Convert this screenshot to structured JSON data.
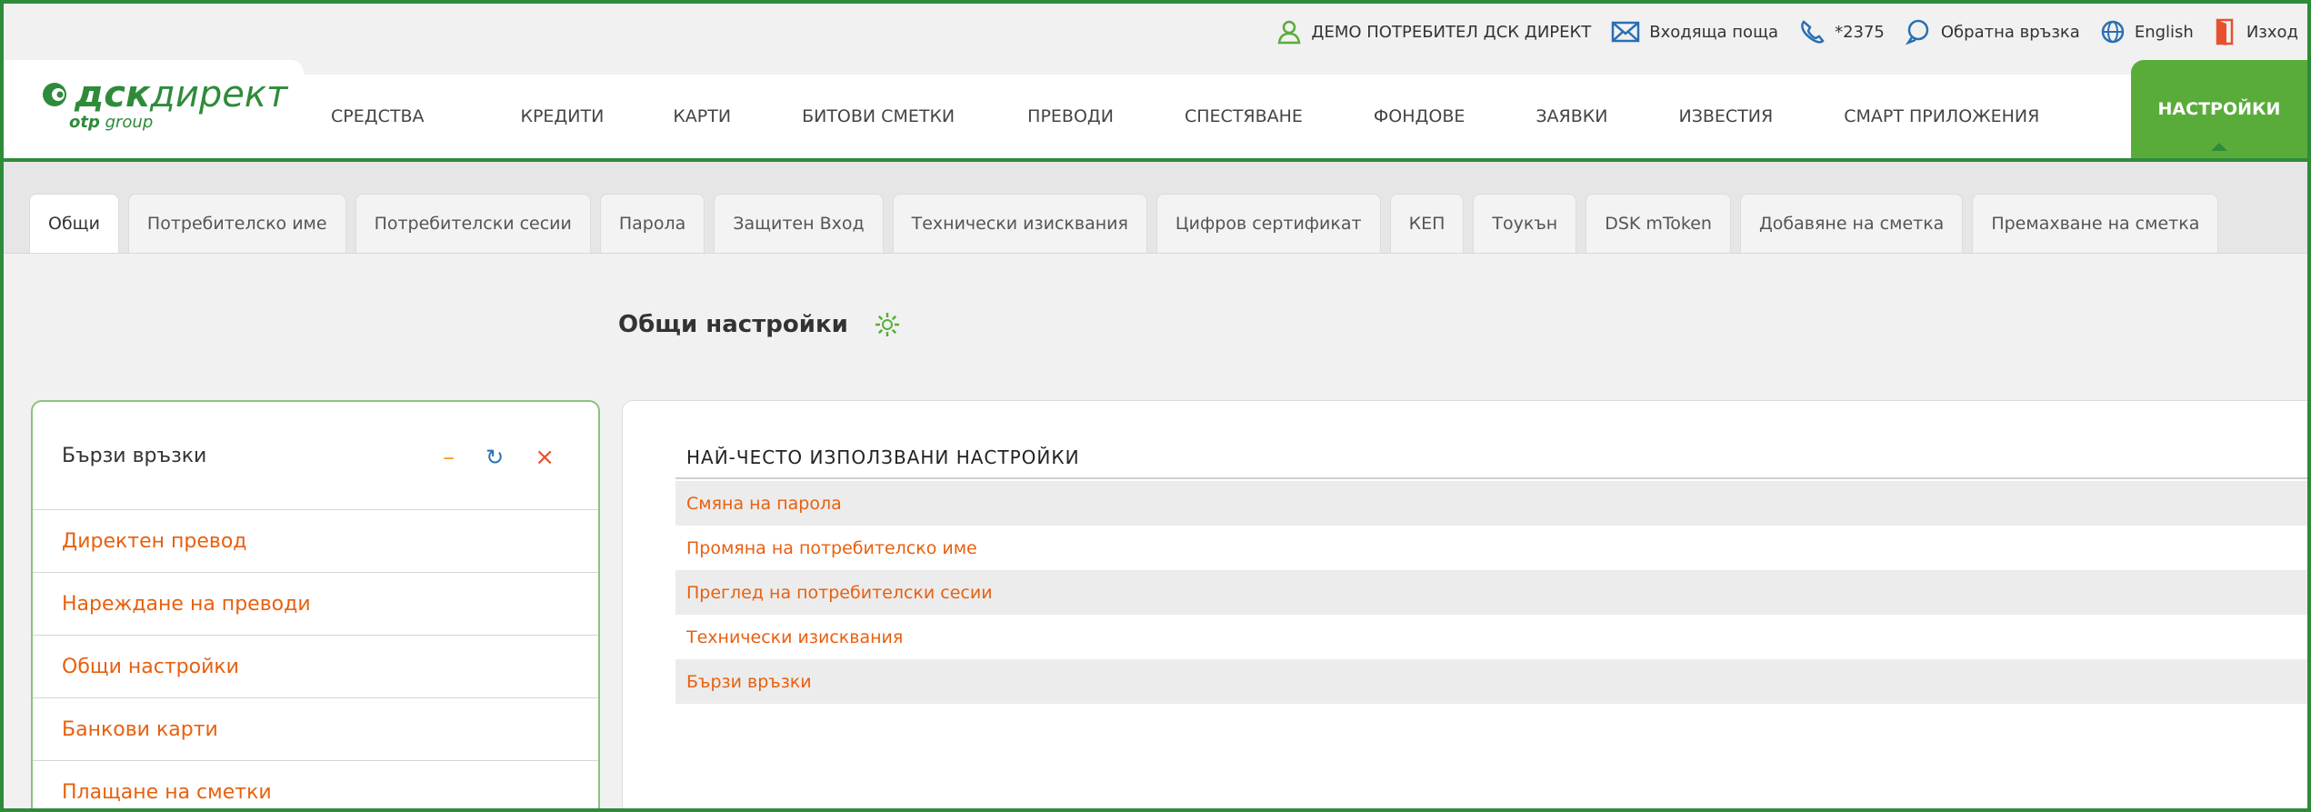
{
  "colors": {
    "brand_green": "#2e8b3a",
    "active_green": "#5aac3a",
    "link_orange": "#e8600f"
  },
  "topbar": {
    "user": "ДЕМО ПОТРЕБИТЕЛ ДСК ДИРЕКТ",
    "inbox": "Входяща поща",
    "phone": "*2375",
    "feedback": "Обратна връзка",
    "language": "English",
    "logout": "Изход"
  },
  "logo": {
    "main_bold": "дск",
    "main_light": "директ",
    "sub_bold": "otp",
    "sub_light": " group"
  },
  "nav": {
    "items": [
      "СРЕДСТВА",
      "КРЕДИТИ",
      "КАРТИ",
      "БИТОВИ СМЕТКИ",
      "ПРЕВОДИ",
      "СПЕСТЯВАНЕ",
      "ФОНДОВЕ",
      "ЗАЯВКИ",
      "ИЗВЕСТИЯ",
      "СМАРТ ПРИЛОЖЕНИЯ"
    ],
    "active": "НАСТРОЙКИ"
  },
  "tabs": [
    "Общи",
    "Потребителско име",
    "Потребителски сесии",
    "Парола",
    "Защитен Вход",
    "Технически изисквания",
    "Цифров сертификат",
    "КЕП",
    "Тоукън",
    "DSK mToken",
    "Добавяне на сметка",
    "Премахване на сметка"
  ],
  "page": {
    "title": "Общи настройки"
  },
  "quick_links": {
    "title": "Бързи връзки",
    "items": [
      "Директен превод",
      "Нареждане на преводи",
      "Общи настройки",
      "Банкови карти",
      "Плащане на сметки"
    ]
  },
  "settings": {
    "title": "НАЙ-ЧЕСТО ИЗПОЛЗВАНИ НАСТРОЙКИ",
    "items": [
      "Смяна на парола",
      "Промяна на потребителско име",
      "Преглед на потребителски сесии",
      "Технически изисквания",
      "Бързи връзки"
    ]
  }
}
